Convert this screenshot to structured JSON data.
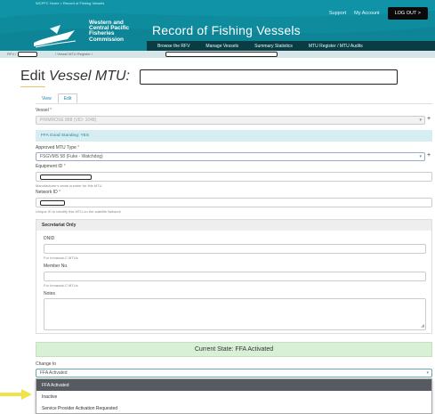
{
  "header": {
    "breadcrumb": "WCPFC Home > Record of Fishing Vessels",
    "links": {
      "support": "Support",
      "my_account": "My Account"
    },
    "logout_label": "LOG OUT >",
    "org_name_lines": [
      "Western and",
      "Central Pacific",
      "Fisheries",
      "Commission"
    ],
    "site_title": "Record of Fishing Vessels",
    "nav": [
      "Browse the RFV",
      "Manage Vessels",
      "Summary Statistics",
      "MTU Register / MTU Audits"
    ]
  },
  "subcrumb": {
    "prefix": "RFV /",
    "middle": "/ Vessel MTU Register /"
  },
  "page": {
    "title_prefix": "Edit ",
    "title_em": "Vessel MTU:",
    "tabs": [
      "View",
      "Edit"
    ]
  },
  "form": {
    "vessel_label": "Vessel",
    "vessel_value": "PRIMROSE 888 (VID: 1048)",
    "info_text": "FFA Good Standing: YES",
    "mtu_type_label": "Approved MTU Type",
    "mtu_type_value": "FSGVMS 58 (Fuke - Watchdog)",
    "equipment_label": "Equipment ID",
    "equipment_help": "Manufacturer's serial number for this MTU",
    "network_label": "Network ID",
    "network_help": "Unique ID to identify this MTU on the satellite Network",
    "required_mark": "*",
    "plus": "+",
    "caret": "▾"
  },
  "secretariat": {
    "heading": "Secretariat Only",
    "dnid_label": "DNID",
    "dnid_help": "For Inmarsat-C MTUs",
    "member_label": "Member No.",
    "member_help": "For Inmarsat-C MTUs",
    "notes_label": "Notes"
  },
  "state": {
    "current_state": "Current State: FFA Activated",
    "change_to_label": "Change to",
    "change_to_value": "FFA Activated"
  },
  "dropdown": {
    "options": [
      "FFA Activated",
      "Inactive",
      "Service Provider Activation Requested"
    ],
    "selected_index": 0
  },
  "colors": {
    "header_bg": "#0f8b9e",
    "nav_bg": "#0a3c44",
    "info_bg": "#d6eef2",
    "state_bg": "#d8f0d6",
    "selected_option_bg": "#555b60",
    "pointer_arrow": "#f2e24a"
  }
}
